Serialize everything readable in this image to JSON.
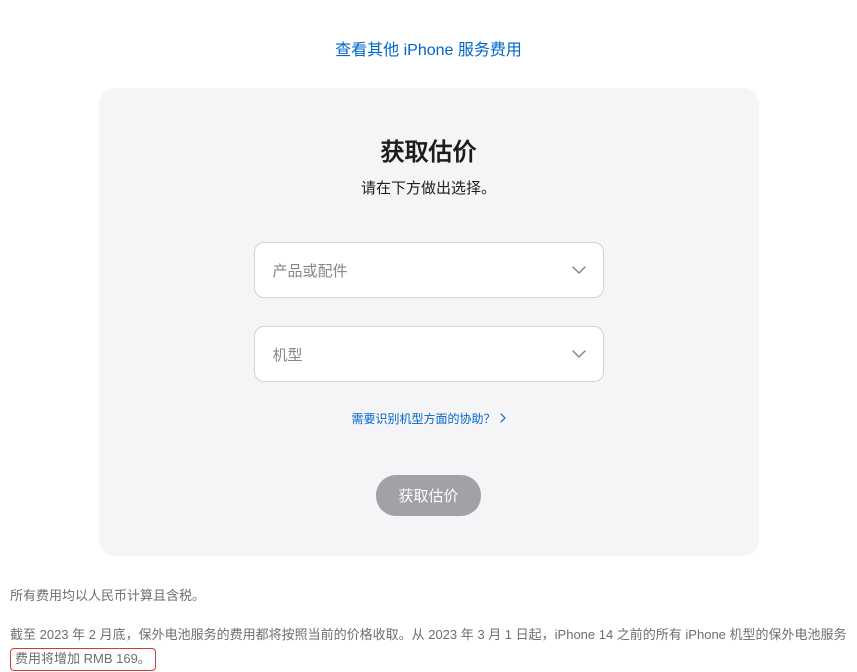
{
  "topLink": "查看其他 iPhone 服务费用",
  "card": {
    "title": "获取估价",
    "subtitle": "请在下方做出选择。",
    "select1": "产品或配件",
    "select2": "机型",
    "helpLink": "需要识别机型方面的协助？",
    "submitButton": "获取估价"
  },
  "footer": {
    "line1": "所有费用均以人民币计算且含税。",
    "line2_part1": "截至 2023 年 2 月底，保外电池服务的费用都将按照当前的价格收取。从 2023 年 3 月 1 日起，iPhone 14 之前的所有 iPhone 机型的保外电池服务",
    "line2_highlight": "费用将增加 RMB 169。"
  }
}
